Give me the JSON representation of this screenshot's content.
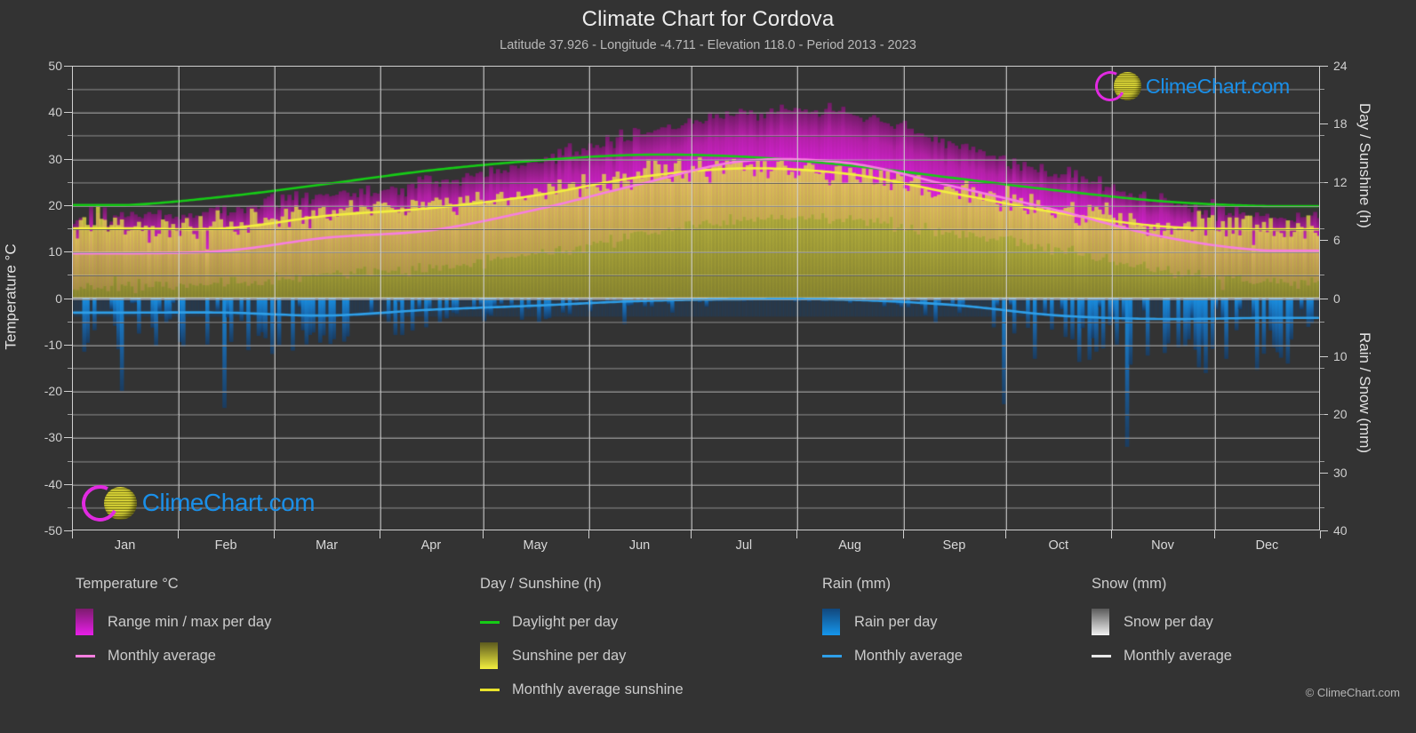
{
  "header": {
    "title": "Climate Chart for Cordova",
    "subtitle": "Latitude 37.926 - Longitude -4.711 - Elevation 118.0 - Period 2013 - 2023"
  },
  "branding": {
    "logo_text": "ClimeChart.com",
    "copyright": "© ClimeChart.com"
  },
  "axes": {
    "left_title": "Temperature °C",
    "right_top_title": "Day / Sunshine (h)",
    "right_bottom_title": "Rain / Snow (mm)",
    "left_ticks": [
      "50",
      "40",
      "30",
      "20",
      "10",
      "0",
      "-10",
      "-20",
      "-30",
      "-40",
      "-50"
    ],
    "right_top_ticks": [
      "24",
      "18",
      "12",
      "6",
      "0"
    ],
    "right_bottom_ticks": [
      "0",
      "10",
      "20",
      "30",
      "40"
    ],
    "x_ticks": [
      "Jan",
      "Feb",
      "Mar",
      "Apr",
      "May",
      "Jun",
      "Jul",
      "Aug",
      "Sep",
      "Oct",
      "Nov",
      "Dec"
    ]
  },
  "legend": {
    "groups": [
      {
        "title": "Temperature °C",
        "items": [
          {
            "label": "Range min / max per day",
            "style": "box",
            "color": "#e81ee8",
            "color2": "#7d1b6e"
          },
          {
            "label": "Monthly average",
            "style": "line",
            "color": "#f77fe0"
          }
        ]
      },
      {
        "title": "Day / Sunshine (h)",
        "items": [
          {
            "label": "Daylight per day",
            "style": "line",
            "color": "#16cc16"
          },
          {
            "label": "Sunshine per day",
            "style": "box",
            "color": "#f2ef3f",
            "color2": "#5c5a1e"
          },
          {
            "label": "Monthly average sunshine",
            "style": "line",
            "color": "#e8e22c"
          }
        ]
      },
      {
        "title": "Rain (mm)",
        "items": [
          {
            "label": "Rain per day",
            "style": "box",
            "color": "#1596ec",
            "color2": "#11477c"
          },
          {
            "label": "Monthly average",
            "style": "line",
            "color": "#2f9fe8"
          }
        ]
      },
      {
        "title": "Snow (mm)",
        "items": [
          {
            "label": "Snow per day",
            "style": "box",
            "color": "#f2f2f2",
            "color2": "#5a5a5a"
          },
          {
            "label": "Monthly average",
            "style": "line",
            "color": "#e8e8e8"
          }
        ]
      }
    ]
  },
  "colors": {
    "background": "#333333",
    "grid": "#8d8d8d",
    "axis": "#d0d0d0",
    "daylight": "#16cc16",
    "temp_avg": "#f77fe0",
    "temp_range": "#e81ee8",
    "sunshine": "#d9d44a",
    "sunshine_avg": "#f2ef3f",
    "rain": "#1596ec",
    "rain_avg": "#2f9fe8",
    "text": "#d9d9d9"
  },
  "chart_data": {
    "type": "line",
    "title": "Climate Chart for Cordova",
    "subtitle": "Latitude 37.926 - Longitude -4.711 - Elevation 118.0 - Period 2013 - 2023",
    "xlabel": "",
    "ylabel": "Temperature °C",
    "ylabel_right_top": "Day / Sunshine (h)",
    "ylabel_right_bottom": "Rain / Snow (mm)",
    "ylim": [
      -50,
      50
    ],
    "ylim_right_top": [
      0,
      24
    ],
    "ylim_right_bottom": [
      0,
      40
    ],
    "grid": true,
    "legend_position": "below",
    "categories": [
      "Jan",
      "Feb",
      "Mar",
      "Apr",
      "May",
      "Jun",
      "Jul",
      "Aug",
      "Sep",
      "Oct",
      "Nov",
      "Dec"
    ],
    "series": [
      {
        "name": "Monthly average temperature",
        "unit": "°C",
        "axis": "left",
        "color": "#f77fe0",
        "values": [
          9.6,
          10.2,
          13.0,
          14.6,
          19.0,
          24.5,
          29.5,
          29.0,
          24.0,
          18.8,
          13.2,
          10.2
        ]
      },
      {
        "name": "Daily maximum temperature (range top)",
        "unit": "°C",
        "axis": "left",
        "color": "#e81ee8",
        "values": [
          16.0,
          17.5,
          21.0,
          23.0,
          28.0,
          34.0,
          39.0,
          38.5,
          32.0,
          25.5,
          19.5,
          16.0
        ]
      },
      {
        "name": "Daily minimum temperature (range bottom)",
        "unit": "°C",
        "axis": "left",
        "color": "#e81ee8",
        "values": [
          3.5,
          4.0,
          6.0,
          7.5,
          10.5,
          14.5,
          18.0,
          18.0,
          15.0,
          11.5,
          7.0,
          4.5
        ]
      },
      {
        "name": "Daylight per day",
        "unit": "h",
        "axis": "right_top",
        "color": "#16cc16",
        "values": [
          9.6,
          10.5,
          11.8,
          13.2,
          14.2,
          14.8,
          14.6,
          13.7,
          12.4,
          11.1,
          10.0,
          9.5
        ]
      },
      {
        "name": "Monthly average sunshine",
        "unit": "h",
        "axis": "right_top",
        "color": "#e8e22c",
        "values": [
          7.2,
          7.2,
          8.5,
          9.3,
          10.6,
          12.5,
          13.4,
          12.8,
          10.8,
          8.8,
          7.4,
          7.1
        ]
      },
      {
        "name": "Monthly average rain",
        "unit": "mm",
        "axis": "right_bottom",
        "color": "#2f9fe8",
        "values": [
          2.5,
          2.5,
          3.0,
          2.0,
          1.3,
          0.5,
          0.2,
          0.3,
          1.2,
          3.0,
          3.6,
          3.4
        ]
      },
      {
        "name": "Monthly average snow",
        "unit": "mm",
        "axis": "right_bottom",
        "color": "#e8e8e8",
        "values": [
          0,
          0,
          0,
          0,
          0,
          0,
          0,
          0,
          0,
          0,
          0,
          0
        ]
      }
    ]
  }
}
